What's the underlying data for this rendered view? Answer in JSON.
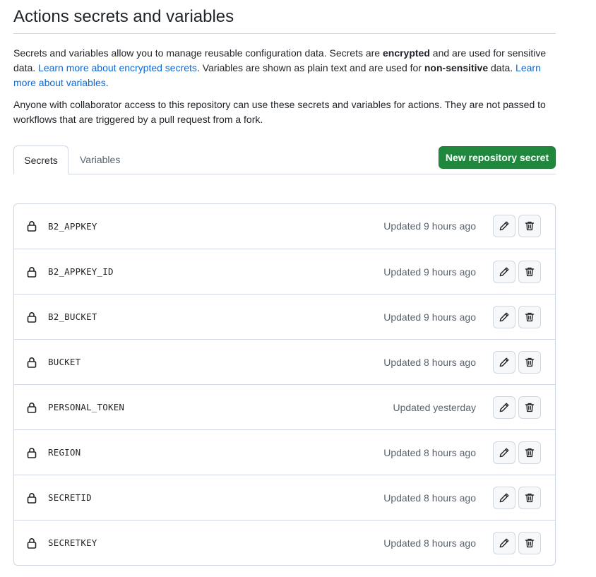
{
  "page": {
    "title": "Actions secrets and variables"
  },
  "intro": {
    "p1_a": "Secrets and variables allow you to manage reusable configuration data. Secrets are ",
    "p1_b": "encrypted",
    "p1_c": " and are used for sensitive data. ",
    "p1_link1": "Learn more about encrypted secrets",
    "p1_d": ". Variables are shown as plain text and are used for ",
    "p1_e": "non-sensitive",
    "p1_f": " data. ",
    "p1_link2": "Learn more about variables",
    "p1_g": ".",
    "p2": "Anyone with collaborator access to this repository can use these secrets and variables for actions. They are not passed to workflows that are triggered by a pull request from a fork."
  },
  "tabs": [
    {
      "label": "Secrets",
      "active": true
    },
    {
      "label": "Variables",
      "active": false
    }
  ],
  "actions": {
    "new_secret_label": "New repository secret"
  },
  "secrets": [
    {
      "name": "B2_APPKEY",
      "updated": "Updated 9 hours ago"
    },
    {
      "name": "B2_APPKEY_ID",
      "updated": "Updated 9 hours ago"
    },
    {
      "name": "B2_BUCKET",
      "updated": "Updated 9 hours ago"
    },
    {
      "name": "BUCKET",
      "updated": "Updated 8 hours ago"
    },
    {
      "name": "PERSONAL_TOKEN",
      "updated": "Updated yesterday"
    },
    {
      "name": "REGION",
      "updated": "Updated 8 hours ago"
    },
    {
      "name": "SECRETID",
      "updated": "Updated 8 hours ago"
    },
    {
      "name": "SECRETKEY",
      "updated": "Updated 8 hours ago"
    }
  ],
  "icons": {
    "row_lock": "lock-icon",
    "row_edit": "pencil-icon",
    "row_delete": "trash-icon"
  },
  "colors": {
    "primary_button": "#1f883d",
    "link": "#0969da",
    "border": "#d0d7de",
    "muted_text": "#59636e"
  }
}
